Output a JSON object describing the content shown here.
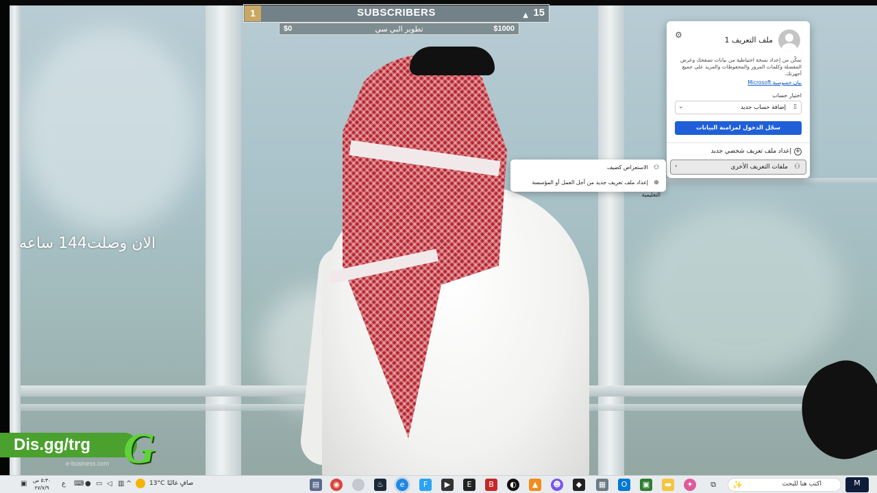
{
  "overlay": {
    "subscribers": {
      "rank": "1",
      "title": "SUBSCRIBERS",
      "count": "15"
    },
    "goal": {
      "current": "$0",
      "label": "تطوير البي سي",
      "target": "$1000"
    },
    "hours_text": "الان وصلت144 ساعه",
    "logo": {
      "text": "Dis.gg/trg",
      "mark": "G",
      "sub": "e-business.com"
    }
  },
  "profile_panel": {
    "name": "ملف التعريف 1",
    "description": "تمكّن من إعداد نسخة احتياطية من بيانات تصفحك وعرض المفضلة وكلمات المرور والمحفوظات والمزيد على جميع أجهزتك.",
    "privacy_link": "بيان خصوصية Microsoft",
    "choose_account_label": "اختيار حساب",
    "account_select_value": "إضافة حساب جديد",
    "signin_button": "سجّل الدخول لمزامنة البيانات",
    "new_profile": "إعداد ملف تعريف شخصي جديد",
    "other_profiles": "ملفات التعريف الأخرى",
    "icons": {
      "settings": "gear-icon",
      "account": "account-icon",
      "add": "plus-circle-icon",
      "profiles": "profiles-icon"
    }
  },
  "submenu": {
    "items": [
      {
        "label": "الاستعراض كضيف",
        "icon": "guest-icon"
      },
      {
        "label": "إعداد ملف تعريف جديد من أجل العمل أو المؤسسة التعليمية",
        "icon": "plus-circle-icon"
      }
    ]
  },
  "taskbar": {
    "search_placeholder": "اكتب هنا للبحث",
    "time": "٥:٣٠ ص",
    "date": "٢٧/٧/٩",
    "weather_temp": "13°C",
    "weather_desc": "صافٍ غالبًا",
    "language": "ع",
    "colors": {
      "edge": "#1e88e5",
      "chrome": "#db4437",
      "vlc": "#f28c1c",
      "word": "#2b579a",
      "outlook": "#0078d4",
      "explorer": "#f5c542"
    }
  }
}
